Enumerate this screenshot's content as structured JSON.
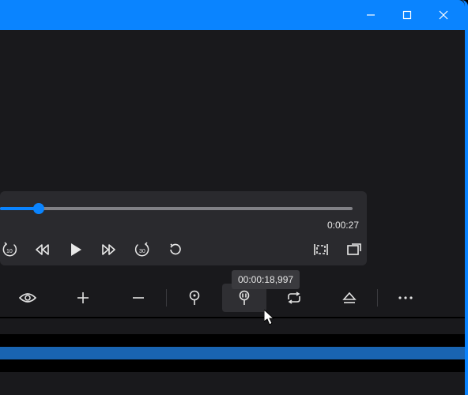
{
  "titlebar": {
    "minimize": "minimize",
    "maximize": "maximize",
    "close": "close"
  },
  "player": {
    "duration_label": "0:00:27"
  },
  "tooltip": {
    "text": "00:00:18,997"
  },
  "transport": {
    "skip_back_10": "Skip back 10",
    "rewind": "Rewind",
    "play": "Play",
    "forward": "Fast forward",
    "skip_fwd_30": "Skip forward 30",
    "replay": "Replay",
    "fit": "Fit to screen",
    "fullscreen": "Fullscreen"
  },
  "toolbar": {
    "visibility": "Toggle visibility",
    "add": "Add",
    "remove": "Remove",
    "marker_in": "Set in marker",
    "marker_cue": "Cue marker",
    "loop": "Loop",
    "eject": "Eject",
    "more": "More"
  }
}
